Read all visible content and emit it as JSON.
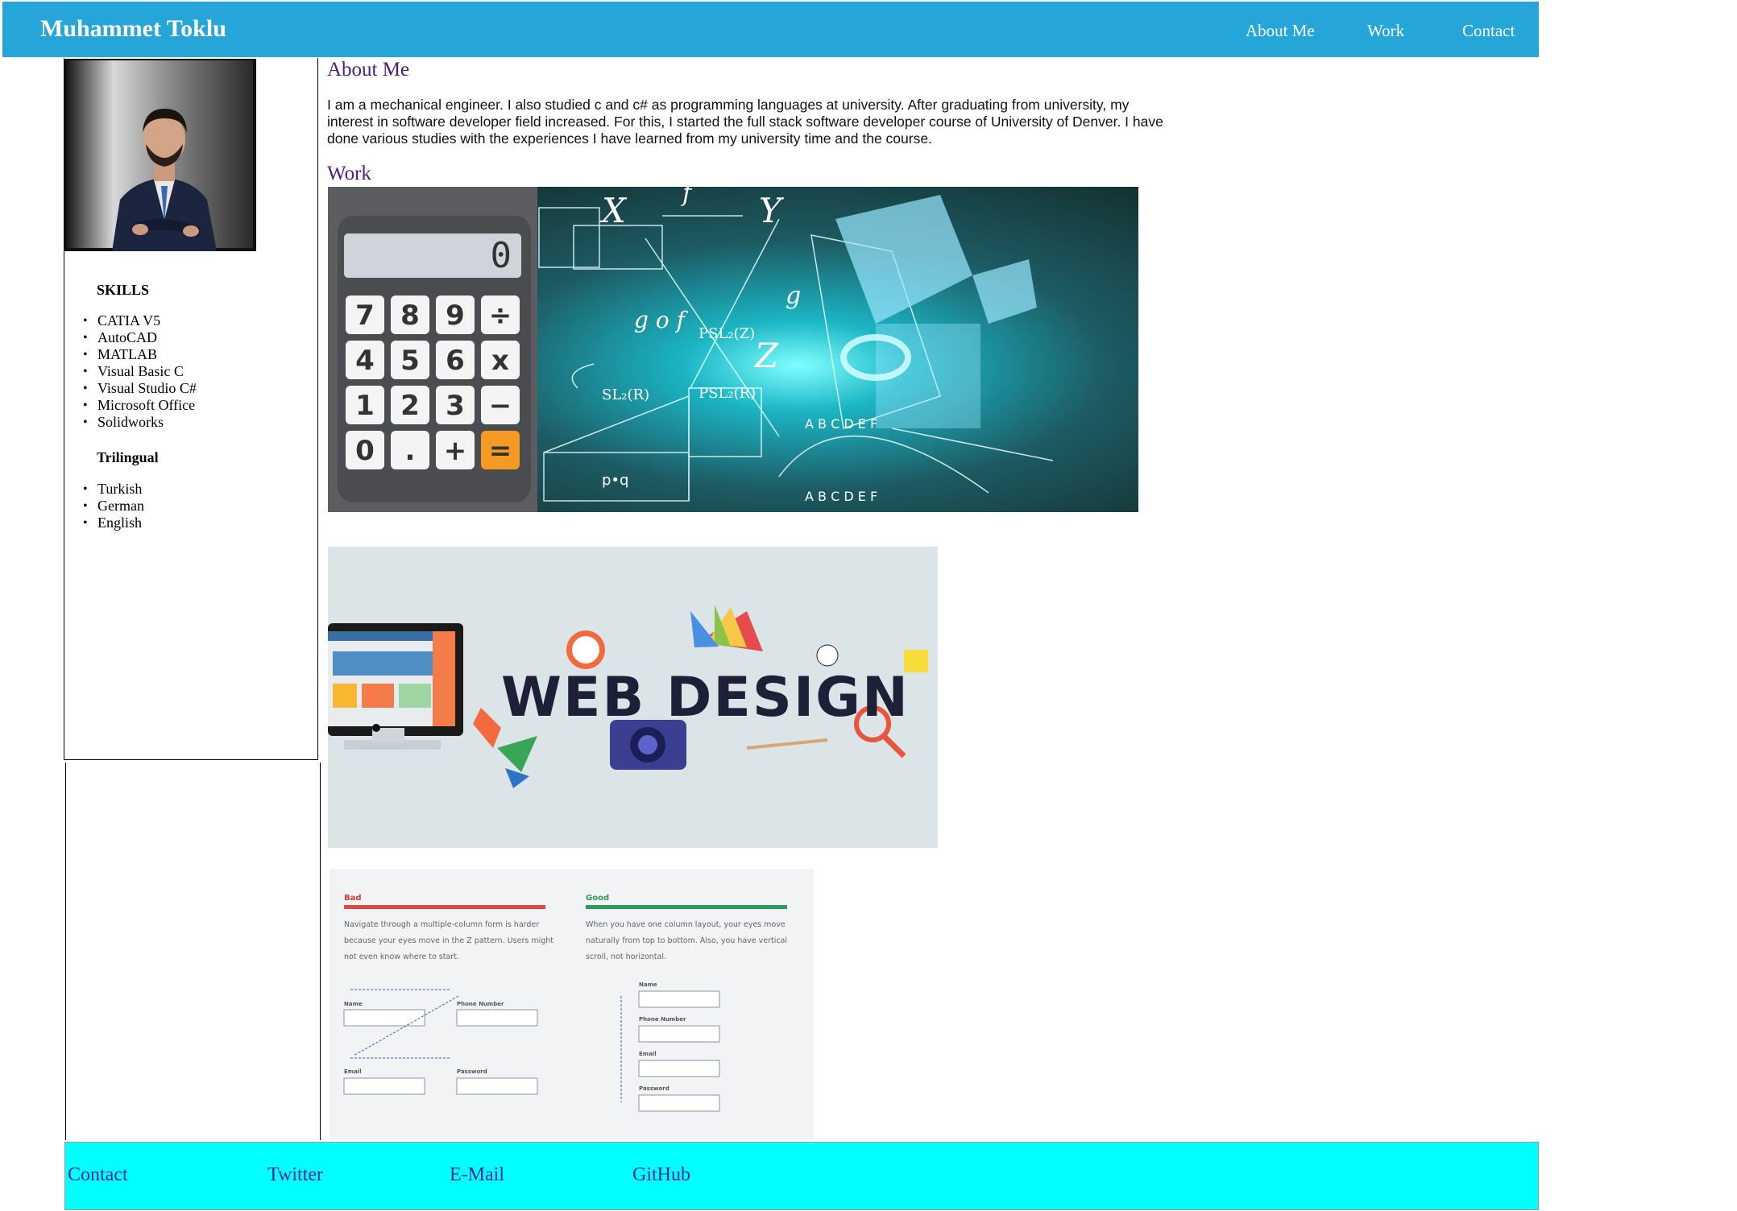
{
  "header": {
    "brand": "Muhammet Toklu",
    "nav": [
      "About Me",
      "Work",
      "Contact"
    ]
  },
  "sidebar": {
    "skills_title": "SKILLS",
    "skills": [
      "CATIA V5",
      "AutoCAD",
      "MATLAB",
      "Visual Basic C",
      "Visual Studio C#",
      "Microsoft Office",
      "Solidworks"
    ],
    "languages_title": "Trilingual",
    "languages": [
      "Turkish",
      "German",
      "English"
    ]
  },
  "about": {
    "title": "About Me",
    "text": "I am a mechanical engineer. I also studied c and c# as programming languages at university. After graduating from university, my interest in software developer field increased. For this, I started the full stack software developer course of University of Denver. I have done various studies with the experiences I have learned from my university time and the course."
  },
  "work": {
    "title": "Work",
    "calculator": {
      "display": "0",
      "keys": [
        "7",
        "8",
        "9",
        "÷",
        "4",
        "5",
        "6",
        "x",
        "1",
        "2",
        "3",
        "−",
        "0",
        ".",
        "+",
        "="
      ]
    },
    "math_image_text": [
      "X",
      "Y",
      "Z",
      "f",
      "g",
      "g o f",
      "PSL₂(Z)",
      "SL₂(R)",
      "PSL₂(R)",
      "p•q",
      "A B C D E F"
    ],
    "web_design_text": "WEB DESIGN",
    "form_image": {
      "bad_label": "Bad",
      "bad_text": "Navigate through a multiple-column form is harder because your eyes move in the Z pattern. Users might not even know where to start.",
      "good_label": "Good",
      "good_text": "When you have one column layout, your eyes move naturally from top to bottom. Also, you have vertical scroll, not horizontal.",
      "fields": [
        "Name",
        "Phone Number",
        "Email",
        "Password"
      ]
    }
  },
  "footer": {
    "links": [
      "Contact",
      "Twitter",
      "E-Mail",
      "GitHub"
    ]
  },
  "colors": {
    "header_bg": "#26a5d8",
    "footer_bg": "#00ffff",
    "heading": "#4b1d7a",
    "footer_link": "#2a2a9a"
  }
}
